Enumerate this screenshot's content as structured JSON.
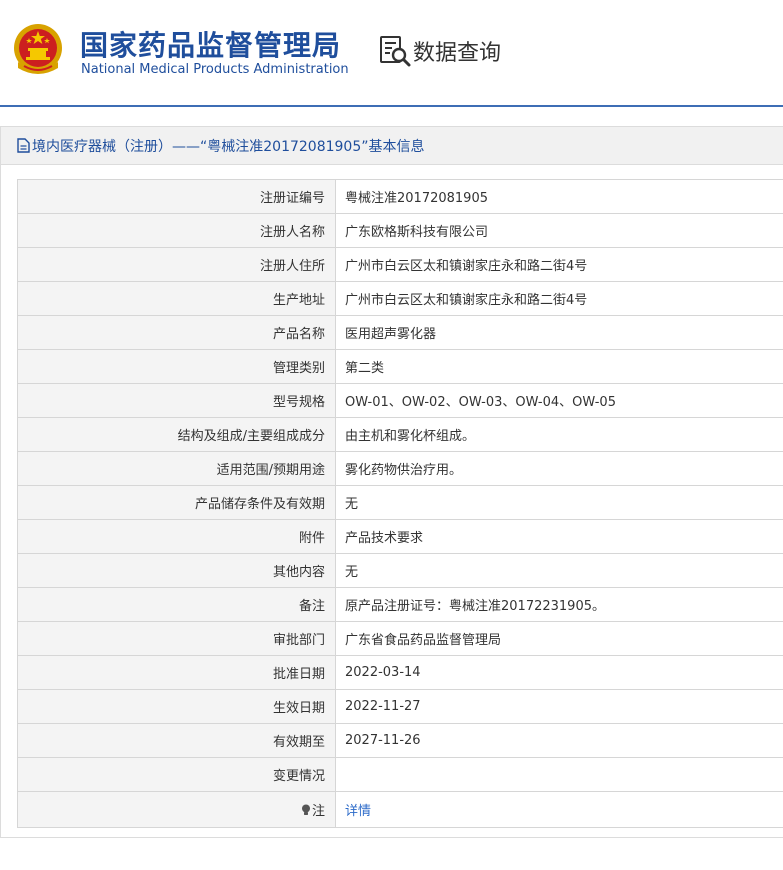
{
  "header": {
    "org_name_cn": "国家药品监督管理局",
    "org_name_en": "National Medical Products Administration",
    "query_label": "数据查询",
    "emblem_icon": "national-emblem-icon",
    "query_icon": "document-search-icon",
    "brand_color": "#1f4e9c"
  },
  "panel": {
    "title": "境内医疗器械（注册）——“粤械注准20172081905”基本信息",
    "title_icon": "document-icon"
  },
  "details": {
    "rows": [
      {
        "label": "注册证编号",
        "value": "粤械注准20172081905"
      },
      {
        "label": "注册人名称",
        "value": "广东欧格斯科技有限公司"
      },
      {
        "label": "注册人住所",
        "value": "广州市白云区太和镇谢家庄永和路二街4号"
      },
      {
        "label": "生产地址",
        "value": "广州市白云区太和镇谢家庄永和路二街4号"
      },
      {
        "label": "产品名称",
        "value": "医用超声雾化器"
      },
      {
        "label": "管理类别",
        "value": "第二类"
      },
      {
        "label": "型号规格",
        "value": "OW-01、OW-02、OW-03、OW-04、OW-05"
      },
      {
        "label": "结构及组成/主要组成成分",
        "value": "由主机和雾化杯组成。"
      },
      {
        "label": "适用范围/预期用途",
        "value": "雾化药物供治疗用。"
      },
      {
        "label": "产品储存条件及有效期",
        "value": "无"
      },
      {
        "label": "附件",
        "value": "产品技术要求"
      },
      {
        "label": "其他内容",
        "value": "无"
      },
      {
        "label": "备注",
        "value": "原产品注册证号：粤械注准20172231905。"
      },
      {
        "label": "审批部门",
        "value": "广东省食品药品监督管理局"
      },
      {
        "label": "批准日期",
        "value": "2022-03-14"
      },
      {
        "label": "生效日期",
        "value": "2022-11-27"
      },
      {
        "label": "有效期至",
        "value": "2027-11-26"
      },
      {
        "label": "变更情况",
        "value": ""
      }
    ],
    "note": {
      "label": "注",
      "link_text": "详情",
      "icon": "lightbulb-icon",
      "link_color": "#2d6bc9"
    }
  }
}
